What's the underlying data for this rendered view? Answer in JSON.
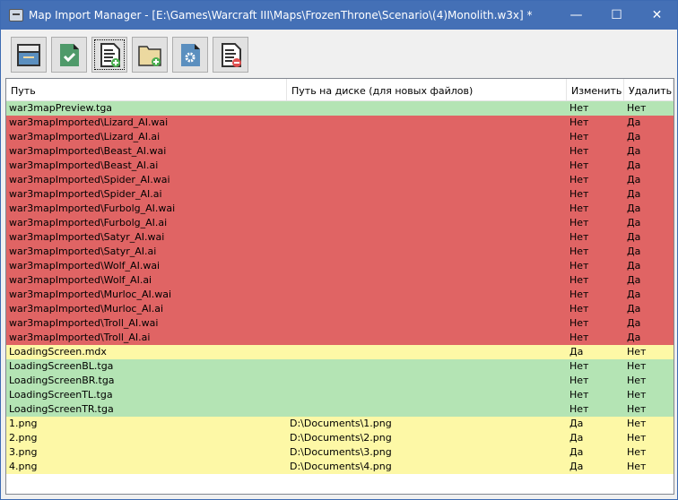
{
  "window": {
    "title": "Map Import Manager - [E:\\Games\\Warcraft III\\Maps\\FrozenThrone\\Scenario\\(4)Monolith.w3x] *",
    "minimize": "—",
    "maximize": "☐",
    "close": "✕"
  },
  "toolbar": [
    {
      "icon": "archive-icon"
    },
    {
      "icon": "save-check-icon"
    },
    {
      "icon": "add-file-icon"
    },
    {
      "icon": "add-folder-icon"
    },
    {
      "icon": "file-settings-icon"
    },
    {
      "icon": "remove-file-icon"
    }
  ],
  "columns": [
    "Путь",
    "Путь на диске (для новых файлов)",
    "Изменить",
    "Удалить"
  ],
  "colors": {
    "green": "#b4e4b4",
    "red": "#e06464",
    "yellow": "#fdf8a6"
  },
  "rows": [
    {
      "path": "war3mapPreview.tga",
      "disk": "",
      "modify": "Нет",
      "delete": "Нет",
      "color": "green"
    },
    {
      "path": "war3mapImported\\Lizard_AI.wai",
      "disk": "",
      "modify": "Нет",
      "delete": "Да",
      "color": "red"
    },
    {
      "path": "war3mapImported\\Lizard_AI.ai",
      "disk": "",
      "modify": "Нет",
      "delete": "Да",
      "color": "red"
    },
    {
      "path": "war3mapImported\\Beast_AI.wai",
      "disk": "",
      "modify": "Нет",
      "delete": "Да",
      "color": "red"
    },
    {
      "path": "war3mapImported\\Beast_AI.ai",
      "disk": "",
      "modify": "Нет",
      "delete": "Да",
      "color": "red"
    },
    {
      "path": "war3mapImported\\Spider_AI.wai",
      "disk": "",
      "modify": "Нет",
      "delete": "Да",
      "color": "red"
    },
    {
      "path": "war3mapImported\\Spider_AI.ai",
      "disk": "",
      "modify": "Нет",
      "delete": "Да",
      "color": "red"
    },
    {
      "path": "war3mapImported\\Furbolg_AI.wai",
      "disk": "",
      "modify": "Нет",
      "delete": "Да",
      "color": "red"
    },
    {
      "path": "war3mapImported\\Furbolg_AI.ai",
      "disk": "",
      "modify": "Нет",
      "delete": "Да",
      "color": "red"
    },
    {
      "path": "war3mapImported\\Satyr_AI.wai",
      "disk": "",
      "modify": "Нет",
      "delete": "Да",
      "color": "red"
    },
    {
      "path": "war3mapImported\\Satyr_AI.ai",
      "disk": "",
      "modify": "Нет",
      "delete": "Да",
      "color": "red"
    },
    {
      "path": "war3mapImported\\Wolf_AI.wai",
      "disk": "",
      "modify": "Нет",
      "delete": "Да",
      "color": "red"
    },
    {
      "path": "war3mapImported\\Wolf_AI.ai",
      "disk": "",
      "modify": "Нет",
      "delete": "Да",
      "color": "red"
    },
    {
      "path": "war3mapImported\\Murloc_AI.wai",
      "disk": "",
      "modify": "Нет",
      "delete": "Да",
      "color": "red"
    },
    {
      "path": "war3mapImported\\Murloc_AI.ai",
      "disk": "",
      "modify": "Нет",
      "delete": "Да",
      "color": "red"
    },
    {
      "path": "war3mapImported\\Troll_AI.wai",
      "disk": "",
      "modify": "Нет",
      "delete": "Да",
      "color": "red"
    },
    {
      "path": "war3mapImported\\Troll_AI.ai",
      "disk": "",
      "modify": "Нет",
      "delete": "Да",
      "color": "red"
    },
    {
      "path": "LoadingScreen.mdx",
      "disk": "",
      "modify": "Да",
      "delete": "Нет",
      "color": "yellow"
    },
    {
      "path": "LoadingScreenBL.tga",
      "disk": "",
      "modify": "Нет",
      "delete": "Нет",
      "color": "green"
    },
    {
      "path": "LoadingScreenBR.tga",
      "disk": "",
      "modify": "Нет",
      "delete": "Нет",
      "color": "green"
    },
    {
      "path": "LoadingScreenTL.tga",
      "disk": "",
      "modify": "Нет",
      "delete": "Нет",
      "color": "green"
    },
    {
      "path": "LoadingScreenTR.tga",
      "disk": "",
      "modify": "Нет",
      "delete": "Нет",
      "color": "green"
    },
    {
      "path": "1.png",
      "disk": "D:\\Documents\\1.png",
      "modify": "Да",
      "delete": "Нет",
      "color": "yellow"
    },
    {
      "path": "2.png",
      "disk": "D:\\Documents\\2.png",
      "modify": "Да",
      "delete": "Нет",
      "color": "yellow"
    },
    {
      "path": "3.png",
      "disk": "D:\\Documents\\3.png",
      "modify": "Да",
      "delete": "Нет",
      "color": "yellow"
    },
    {
      "path": "4.png",
      "disk": "D:\\Documents\\4.png",
      "modify": "Да",
      "delete": "Нет",
      "color": "yellow"
    }
  ]
}
